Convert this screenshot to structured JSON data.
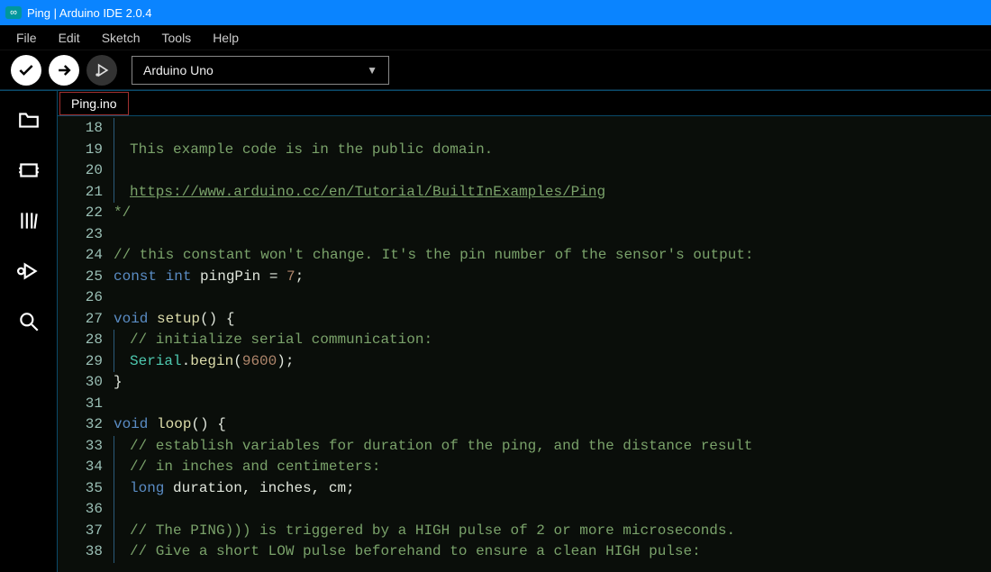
{
  "window": {
    "title": "Ping | Arduino IDE 2.0.4"
  },
  "menu": {
    "file": "File",
    "edit": "Edit",
    "sketch": "Sketch",
    "tools": "Tools",
    "help": "Help"
  },
  "toolbar": {
    "board_selected": "Arduino Uno"
  },
  "tabs": {
    "active": "Ping.ino"
  },
  "code": {
    "first_line_no": 18,
    "lines": [
      {
        "n": 18,
        "indent": 1,
        "tokens": []
      },
      {
        "n": 19,
        "indent": 1,
        "tokens": [
          {
            "cls": "tk-comment",
            "t": "This example code is in the public domain."
          }
        ]
      },
      {
        "n": 20,
        "indent": 1,
        "tokens": []
      },
      {
        "n": 21,
        "indent": 1,
        "tokens": [
          {
            "cls": "tk-link",
            "t": "https://www.arduino.cc/en/Tutorial/BuiltInExamples/Ping"
          }
        ]
      },
      {
        "n": 22,
        "indent": 0,
        "tokens": [
          {
            "cls": "tk-comment",
            "t": "*/"
          }
        ]
      },
      {
        "n": 23,
        "indent": 0,
        "tokens": []
      },
      {
        "n": 24,
        "indent": 0,
        "tokens": [
          {
            "cls": "tk-comment",
            "t": "// this constant won't change. It's the pin number of the sensor's output:"
          }
        ]
      },
      {
        "n": 25,
        "indent": 0,
        "tokens": [
          {
            "cls": "tk-keyword",
            "t": "const "
          },
          {
            "cls": "tk-type",
            "t": "int "
          },
          {
            "cls": "tk-ident",
            "t": "pingPin "
          },
          {
            "cls": "tk-punc",
            "t": "= "
          },
          {
            "cls": "tk-number",
            "t": "7"
          },
          {
            "cls": "tk-punc",
            "t": ";"
          }
        ]
      },
      {
        "n": 26,
        "indent": 0,
        "tokens": []
      },
      {
        "n": 27,
        "indent": 0,
        "tokens": [
          {
            "cls": "tk-keyword",
            "t": "void "
          },
          {
            "cls": "tk-func",
            "t": "setup"
          },
          {
            "cls": "tk-punc",
            "t": "() {"
          }
        ]
      },
      {
        "n": 28,
        "indent": 1,
        "tokens": [
          {
            "cls": "tk-comment",
            "t": "// initialize serial communication:"
          }
        ]
      },
      {
        "n": 29,
        "indent": 1,
        "tokens": [
          {
            "cls": "tk-serial",
            "t": "Serial"
          },
          {
            "cls": "tk-punc",
            "t": "."
          },
          {
            "cls": "tk-func",
            "t": "begin"
          },
          {
            "cls": "tk-punc",
            "t": "("
          },
          {
            "cls": "tk-number",
            "t": "9600"
          },
          {
            "cls": "tk-punc",
            "t": ");"
          }
        ]
      },
      {
        "n": 30,
        "indent": 0,
        "tokens": [
          {
            "cls": "tk-punc",
            "t": "}"
          }
        ]
      },
      {
        "n": 31,
        "indent": 0,
        "tokens": []
      },
      {
        "n": 32,
        "indent": 0,
        "tokens": [
          {
            "cls": "tk-keyword",
            "t": "void "
          },
          {
            "cls": "tk-func",
            "t": "loop"
          },
          {
            "cls": "tk-punc",
            "t": "() {"
          }
        ]
      },
      {
        "n": 33,
        "indent": 1,
        "tokens": [
          {
            "cls": "tk-comment",
            "t": "// establish variables for duration of the ping, and the distance result"
          }
        ]
      },
      {
        "n": 34,
        "indent": 1,
        "tokens": [
          {
            "cls": "tk-comment",
            "t": "// in inches and centimeters:"
          }
        ]
      },
      {
        "n": 35,
        "indent": 1,
        "tokens": [
          {
            "cls": "tk-keyword",
            "t": "long "
          },
          {
            "cls": "tk-ident",
            "t": "duration"
          },
          {
            "cls": "tk-punc",
            "t": ", "
          },
          {
            "cls": "tk-ident",
            "t": "inches"
          },
          {
            "cls": "tk-punc",
            "t": ", "
          },
          {
            "cls": "tk-ident",
            "t": "cm"
          },
          {
            "cls": "tk-punc",
            "t": ";"
          }
        ]
      },
      {
        "n": 36,
        "indent": 1,
        "tokens": []
      },
      {
        "n": 37,
        "indent": 1,
        "tokens": [
          {
            "cls": "tk-comment",
            "t": "// The PING))) is triggered by a HIGH pulse of 2 or more microseconds."
          }
        ]
      },
      {
        "n": 38,
        "indent": 1,
        "tokens": [
          {
            "cls": "tk-comment",
            "t": "// Give a short LOW pulse beforehand to ensure a clean HIGH pulse:"
          }
        ]
      }
    ]
  }
}
